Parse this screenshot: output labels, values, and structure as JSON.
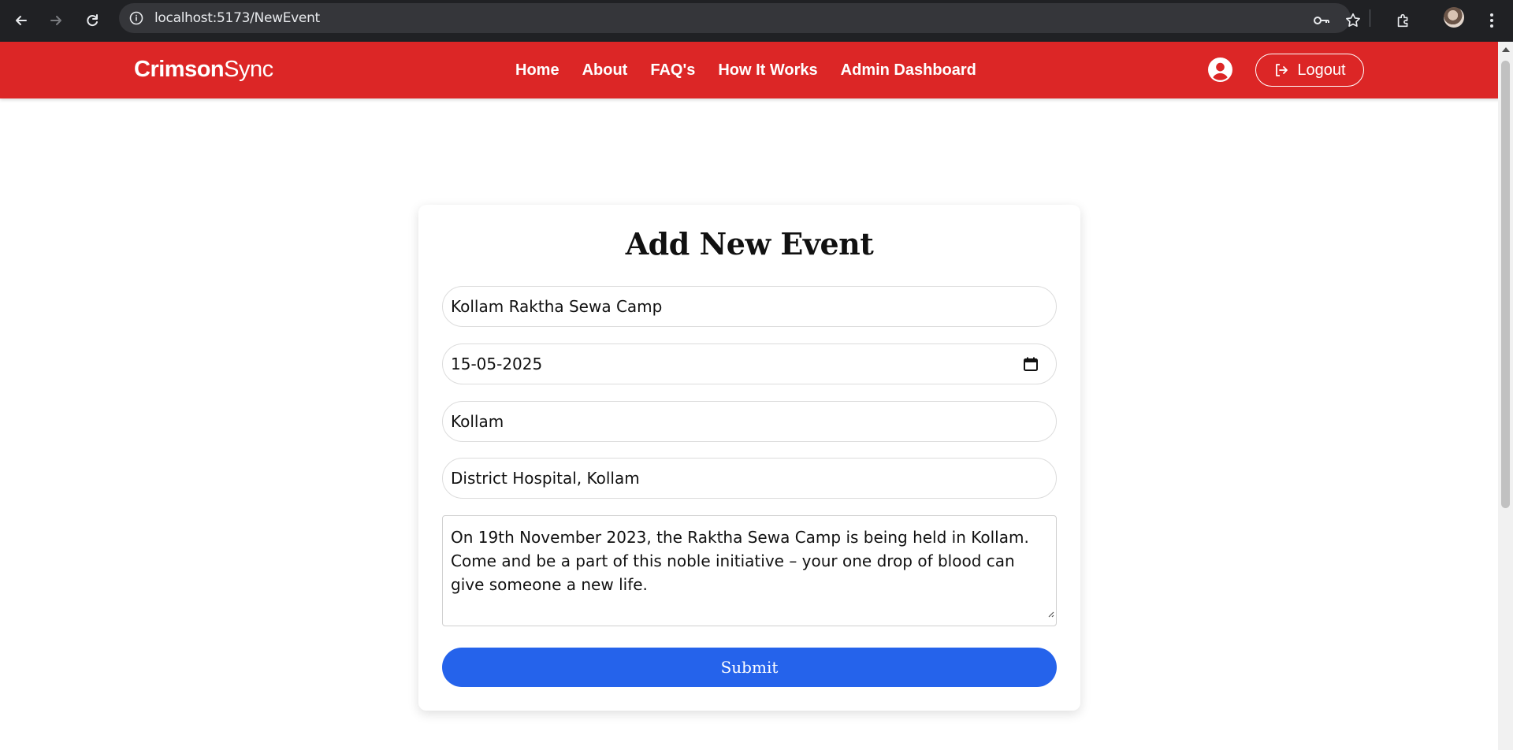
{
  "browser": {
    "url": "localhost:5173/NewEvent",
    "icons": [
      "back-arrow-icon",
      "forward-arrow-icon",
      "reload-icon",
      "site-info-icon",
      "password-key-icon",
      "bookmark-star-icon",
      "extensions-icon",
      "profile-avatar",
      "menu-kebab-icon"
    ]
  },
  "header": {
    "logo_bold": "Crimson",
    "logo_light": "Sync",
    "nav": [
      "Home",
      "About",
      "FAQ's",
      "How It Works",
      "Admin Dashboard"
    ],
    "logout_label": "Logout",
    "colors": {
      "background": "#dc2626",
      "text": "#ffffff"
    }
  },
  "form": {
    "title": "Add New Event",
    "event_name": "Kollam Raktha Sewa Camp",
    "event_date": "15-05-2025",
    "city": "Kollam",
    "venue": "District Hospital, Kollam",
    "description": "On 19th November 2023, the Raktha Sewa Camp is being held in Kollam. Come and be a part of this noble initiative – your one drop of blood can give someone a new life.",
    "submit_label": "Submit",
    "colors": {
      "submit_bg": "#2563eb"
    }
  }
}
